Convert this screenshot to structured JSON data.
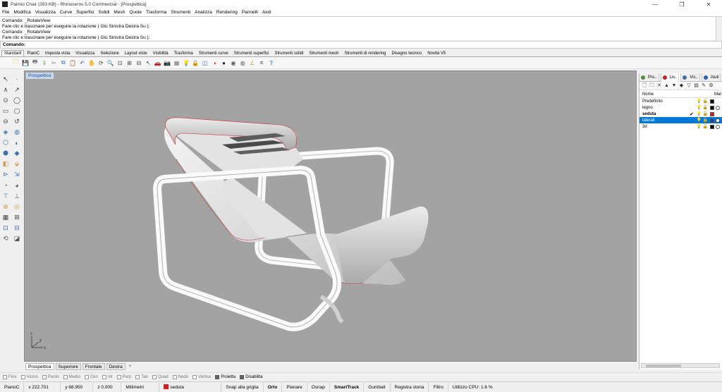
{
  "window": {
    "title": "Paimio Chair (393 KB) - Rhinoceros 5.0 Commercial - [Prospettica]",
    "controls": [
      "—",
      "❐",
      "✕"
    ]
  },
  "menu": [
    "File",
    "Modifica",
    "Visualizza",
    "Curve",
    "Superfici",
    "Solidi",
    "Mesh",
    "Quote",
    "Trasforma",
    "Strumenti",
    "Analizza",
    "Rendering",
    "Pannelli",
    "Aiuti"
  ],
  "command_history": [
    "Comando: _RotateView",
    "Fare clic e trascinare per eseguire la rotazione ( Giù  Sinistra  Destra  Su ):",
    "Comando: _RotateView",
    "Fare clic e trascinare per eseguire la rotazione ( Giù  Sinistra  Destra  Su ):"
  ],
  "command_prompt": "Comando:",
  "toolbar_tabs": [
    "Standard",
    "PianiC",
    "Imposta vista",
    "Visualizza",
    "Selezione",
    "Layout viste",
    "Visibilità",
    "Trasforma",
    "Strumenti curve",
    "Strumenti superfici",
    "Strumenti solidi",
    "Strumenti mesh",
    "Strumenti di rendering",
    "Disegno tecnico",
    "Novità V5"
  ],
  "toolbar_icons": [
    "new-icon",
    "open-icon",
    "save-icon",
    "print-icon",
    "import-icon",
    "cut-icon",
    "copy-icon",
    "paste-icon",
    "undo-icon",
    "pan-icon",
    "rotate-icon",
    "zoom-icon",
    "zoom-window-icon",
    "zoom-extents-icon",
    "zoom-selected-icon",
    "select-icon",
    "car-icon",
    "camera-icon",
    "grid-icon",
    "light-icon",
    "lock-icon",
    "layer-icon",
    "render-icon",
    "sphere-icon",
    "shaded-sphere-icon",
    "material-icon",
    "dimension-icon",
    "group-icon",
    "help-icon"
  ],
  "left_tools": [
    "↖",
    "·",
    "∧",
    "↗",
    "⊙",
    "◯",
    "▭",
    "▢",
    "⊖",
    "↺",
    "◈",
    "◍",
    "⬡",
    "◐",
    "⬢",
    "◆",
    "◧",
    "⬙",
    "⊳",
    "⇲",
    "◔",
    "◕",
    "⊤",
    "⊥",
    "⊕",
    "◎",
    "▦",
    "⊞",
    "⊡",
    "⊟",
    "⟲",
    "◪"
  ],
  "viewport": {
    "title": "Prospettica",
    "axis_labels": {
      "x": "x",
      "y": "y",
      "z": "z"
    }
  },
  "viewport_tabs": [
    "Prospettica",
    "Superiore",
    "Frontale",
    "Destra"
  ],
  "osnap": [
    {
      "label": "Fine",
      "on": false
    },
    {
      "label": "Vicino",
      "on": false
    },
    {
      "label": "Punto",
      "on": false
    },
    {
      "label": "Medio",
      "on": false
    },
    {
      "label": "Cen",
      "on": false
    },
    {
      "label": "Int",
      "on": false
    },
    {
      "label": "Perp",
      "on": false
    },
    {
      "label": "Tan",
      "on": false
    },
    {
      "label": "Quad",
      "on": false
    },
    {
      "label": "Nodo",
      "on": false
    },
    {
      "label": "Vertice",
      "on": false
    },
    {
      "label": "Proietta",
      "on": true
    },
    {
      "label": "Disabilita",
      "on": true
    }
  ],
  "status": {
    "cplane": "PianoC",
    "x": "x 222.701",
    "y": "y 66.950",
    "z": "z 0.000",
    "units": "Millimetri",
    "layer": "seduta",
    "layer_color": "#d42020",
    "snap_grid": "Snap alla griglia",
    "ortho": "Orto",
    "planar": "Planare",
    "osnap": "Osnap",
    "smarttrack": "SmartTrack",
    "gumball": "Gumball",
    "history": "Registra storia",
    "filter": "Filtro",
    "cpu": "Utilizzo CPU: 1.6 %"
  },
  "panel": {
    "tabs": [
      "Pro..",
      "Liv..",
      "Vis..",
      "Aiuti"
    ],
    "header_name": "Nome",
    "header_mat": "Mat",
    "layers": [
      {
        "name": "Predefinito",
        "color": "#000000",
        "current": false,
        "selected": false,
        "bold": false,
        "material": false
      },
      {
        "name": "legno",
        "color": "#000000",
        "current": false,
        "selected": false,
        "bold": false,
        "material": true
      },
      {
        "name": "seduta",
        "color": "#d42020",
        "current": true,
        "selected": false,
        "bold": true,
        "material": false
      },
      {
        "name": "laterali",
        "color": "#1a3fb0",
        "current": false,
        "selected": true,
        "bold": false,
        "material": true
      },
      {
        "name": "3d",
        "color": "#000000",
        "current": false,
        "selected": false,
        "bold": false,
        "material": true
      }
    ]
  },
  "colors": {
    "viewport_bg": "#a3a3a3",
    "selection_edge": "#d42020",
    "accent": "#0078d7"
  }
}
